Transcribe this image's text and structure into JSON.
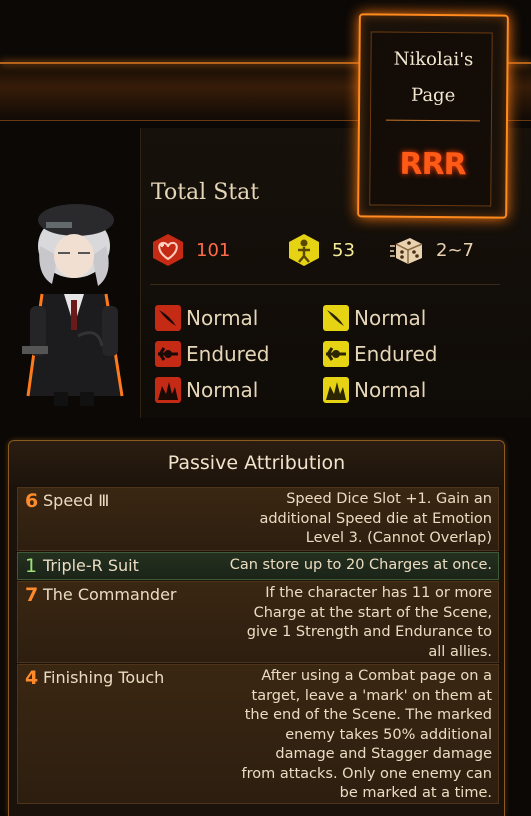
{
  "page_card": {
    "title": "Nikolai's\nPage",
    "emblem_text": "RRR"
  },
  "total_stat": {
    "label": "Total Stat",
    "hp": "101",
    "stagger": "53",
    "speed": "2~7"
  },
  "resistances": {
    "physical": [
      {
        "type": "slash",
        "value": "Normal"
      },
      {
        "type": "pierce",
        "value": "Endured"
      },
      {
        "type": "blunt",
        "value": "Normal"
      }
    ],
    "stagger": [
      {
        "type": "slash",
        "value": "Normal"
      },
      {
        "type": "pierce",
        "value": "Endured"
      },
      {
        "type": "blunt",
        "value": "Normal"
      }
    ]
  },
  "passive": {
    "header": "Passive Attribution",
    "items": [
      {
        "cost": "6",
        "name": "Speed Ⅲ",
        "desc": "Speed Dice Slot +1. Gain an additional Speed die at Emotion Level 3. (Cannot Overlap)"
      },
      {
        "cost": "1",
        "name": "Triple-R Suit",
        "desc": "Can store up to 20 Charges at once."
      },
      {
        "cost": "7",
        "name": "The Commander",
        "desc": "If the character has 11 or more Charge at the start of the Scene, give 1 Strength and Endurance to all allies."
      },
      {
        "cost": "4",
        "name": "Finishing Touch",
        "desc": "After using a Combat page on a target, leave a 'mark' on them at the end of the Scene. The marked enemy takes 50% additional damage and Stagger damage from attacks. Only one enemy can be marked at a time."
      }
    ]
  },
  "colors": {
    "accent": "#ff8a1e",
    "physical": "#e03a1c",
    "stagger": "#f2e21a",
    "speed": "#e8d2b0"
  }
}
